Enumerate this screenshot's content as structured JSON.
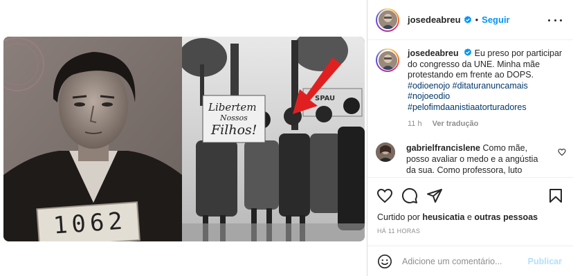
{
  "post": {
    "username": "josedeabreu",
    "follow_label": "Seguir",
    "dot": "•"
  },
  "media": {
    "left_photo": {
      "prisoner_number": "1062"
    },
    "right_photo": {
      "sign_line1": "Libertem",
      "sign_line2": "Nossos",
      "sign_line3": "Filhos!",
      "banner_text": "SPAU"
    }
  },
  "caption": {
    "username": "josedeabreu",
    "text": "Eu preso por participar do congresso da UNE. Minha mãe protestando em frente ao DOPS.",
    "hashtags": [
      "#odioenojo",
      "#ditaturanuncamais",
      "#nojoeodio",
      "#pelofimdaanistiaatorturadores"
    ],
    "time": "11 h",
    "translate_label": "Ver tradução"
  },
  "comment": {
    "username": "gabrielfrancislene",
    "text": "Como mãe, posso avaliar o medo e a angústia da sua. Como professora, luto todos"
  },
  "likes": {
    "prefix": "Curtido por",
    "user": "heusicatia",
    "connector": "e",
    "others": "outras pessoas"
  },
  "time_ago": "HÁ 11 HORAS",
  "comment_form": {
    "placeholder": "Adicione um comentário...",
    "post_label": "Publicar"
  },
  "icons": {
    "verified": "verified-badge-icon",
    "more": "more-options-icon",
    "like": "heart-icon",
    "comment": "comment-icon",
    "share": "paper-plane-icon",
    "save": "bookmark-icon",
    "emoji": "emoji-icon"
  },
  "colors": {
    "link_blue": "#0095f6",
    "hashtag_blue": "#00376b",
    "muted": "#8e8e8e",
    "post_disabled": "#b2dffc"
  }
}
